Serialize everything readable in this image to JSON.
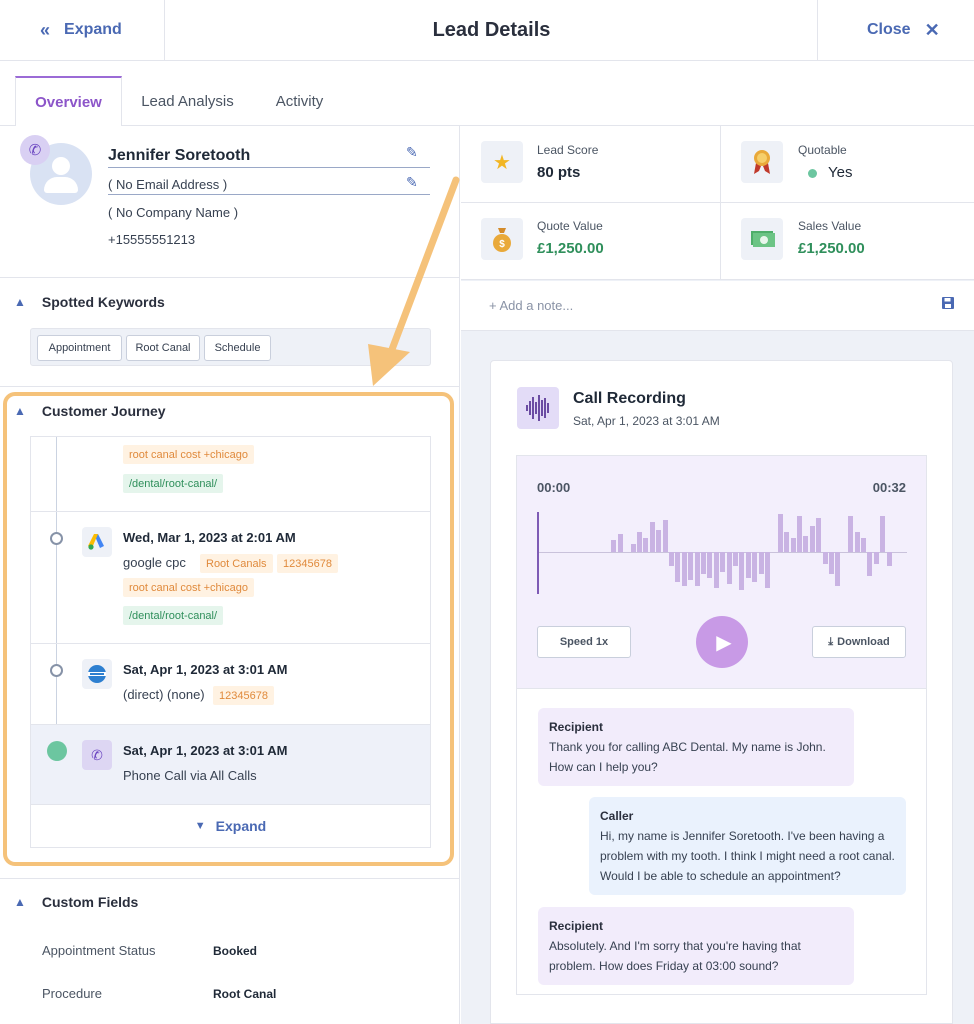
{
  "header": {
    "expand_label": "Expand",
    "title": "Lead Details",
    "close_label": "Close"
  },
  "tabs": [
    {
      "label": "Overview"
    },
    {
      "label": "Lead Analysis"
    },
    {
      "label": "Activity"
    }
  ],
  "contact": {
    "name": "Jennifer Soretooth",
    "email": "( No Email Address )",
    "company": "( No Company Name )",
    "phone": "+15555551213"
  },
  "keywords": {
    "title": "Spotted Keywords",
    "items": [
      "Appointment",
      "Root Canal",
      "Schedule"
    ]
  },
  "journey": {
    "title": "Customer Journey",
    "entry0": {
      "keyword": "root canal cost +chicago",
      "path": "/dental/root-canal/"
    },
    "entry1": {
      "date": "Wed, Mar 1, 2023 at 2:01 AM",
      "source": "google cpc",
      "tag1": "Root Canals",
      "tag2": "12345678",
      "keyword": "root canal cost +chicago",
      "path": "/dental/root-canal/"
    },
    "entry2": {
      "date": "Sat, Apr 1, 2023 at 3:01 AM",
      "source": "(direct) (none)",
      "tag1": "12345678"
    },
    "entry3": {
      "date": "Sat, Apr 1, 2023 at 3:01 AM",
      "source": "Phone Call via All Calls"
    },
    "expand_label": "Expand"
  },
  "custom_fields": {
    "title": "Custom Fields",
    "rows": [
      {
        "label": "Appointment Status",
        "value": "Booked"
      },
      {
        "label": "Procedure",
        "value": "Root Canal"
      }
    ]
  },
  "stats": {
    "lead_score": {
      "label": "Lead Score",
      "value": "80 pts"
    },
    "quotable": {
      "label": "Quotable",
      "value": "Yes"
    },
    "quote_value": {
      "label": "Quote Value",
      "value": "£1,250.00"
    },
    "sales_value": {
      "label": "Sales Value",
      "value": "£1,250.00"
    }
  },
  "note": {
    "placeholder": "+ Add a note..."
  },
  "recording": {
    "title": "Call Recording",
    "date": "Sat, Apr 1, 2023 at 3:01 AM",
    "time_start": "00:00",
    "time_end": "00:32",
    "speed_label": "Speed 1x",
    "download_label": "Download"
  },
  "transcript": [
    {
      "speaker": "Recipient",
      "text": "Thank you for calling ABC Dental. My name is John. How can I help you?"
    },
    {
      "speaker": "Caller",
      "text": "Hi, my name is Jennifer Soretooth. I've been having a problem with my tooth. I think I might need a root canal. Would I be able to schedule an appointment?"
    },
    {
      "speaker": "Recipient",
      "text": "Absolutely. And I'm sorry that you're having that problem. How does Friday at 03:00 sound?"
    }
  ],
  "colors": {
    "accent": "#4a69b3",
    "purple": "#8c55c9",
    "highlight": "#f5c27a",
    "green": "#2f8f5b"
  }
}
